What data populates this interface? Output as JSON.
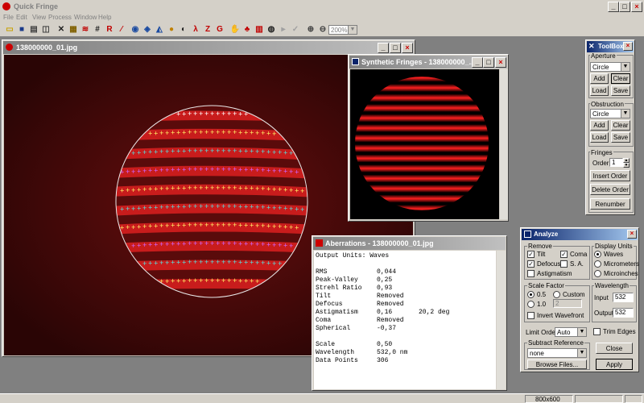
{
  "app": {
    "title": "Quick Fringe",
    "menu": [
      "File",
      "Edit",
      "View",
      "Process",
      "Window",
      "Help"
    ],
    "zoom_value": "200%"
  },
  "toolbar_icons": [
    "open-icon",
    "save-icon",
    "print-icon",
    "print-preview-icon",
    "tools-icon",
    "grid-icon",
    "fringe-icon",
    "table-icon",
    "r-icon",
    "measure-icon",
    "sphere-icon",
    "layers-icon",
    "profile-icon",
    "chart-icon",
    "zernike-icon",
    "lambda-icon",
    "z-icon",
    "g-icon",
    "hand-icon",
    "tree-icon",
    "fringe-map-icon",
    "circle-fringe-icon",
    "cursor-icon",
    "check-icon",
    "zoom-in-icon",
    "zoom-out-icon"
  ],
  "toolbar_letters": {
    "r": "R",
    "lambda": "λ",
    "z": "Z",
    "g": "G"
  },
  "image_window": {
    "title": "138000000_01.jpg"
  },
  "synthetic_window": {
    "title": "Synthetic Fringes - 138000000_..."
  },
  "aberrations_window": {
    "title": "Aberrations - 138000000_01.jpg",
    "header": "Output Units: Waves",
    "rows": [
      {
        "label": "RMS",
        "value": "0,044",
        "extra": ""
      },
      {
        "label": "Peak-Valley",
        "value": "0,25",
        "extra": ""
      },
      {
        "label": "Strehl Ratio",
        "value": "0,93",
        "extra": ""
      },
      {
        "label": "Tilt",
        "value": "Removed",
        "extra": ""
      },
      {
        "label": "Defocus",
        "value": "Removed",
        "extra": ""
      },
      {
        "label": "Astigmatism",
        "value": "0,16",
        "extra": "20,2 deg"
      },
      {
        "label": "Coma",
        "value": "Removed",
        "extra": ""
      },
      {
        "label": "Spherical",
        "value": "-0,37",
        "extra": ""
      }
    ],
    "rows2": [
      {
        "label": "Scale",
        "value": "0,50"
      },
      {
        "label": "Wavelength",
        "value": "532,0 nm"
      },
      {
        "label": "Data Points",
        "value": "306"
      }
    ]
  },
  "toolbox": {
    "title": "ToolBox",
    "aperture_label": "Aperture",
    "aperture_value": "Circle",
    "add": "Add",
    "clear": "Clear",
    "load": "Load",
    "save": "Save",
    "obstruction_label": "Obstruction",
    "obstruction_value": "Circle",
    "fringes_label": "Fringes",
    "order_label": "Order",
    "order_value": "1",
    "insert_order": "Insert Order",
    "delete_order": "Delete Order",
    "renumber": "Renumber"
  },
  "analyze": {
    "title": "Analyze",
    "remove_label": "Remove",
    "tilt": "Tilt",
    "coma": "Coma",
    "defocus": "Defocus",
    "sa": "S. A.",
    "astigmatism": "Astigmatism",
    "display_units_label": "Display Units",
    "waves": "Waves",
    "micrometers": "Micrometers",
    "microinches": "Microinches",
    "scale_factor_label": "Scale Factor",
    "scale_05": "0.5",
    "scale_custom": "Custom",
    "scale_10": "1.0",
    "custom_placeholder": "2",
    "invert_wavefront": "Invert Wavefront",
    "wavelength_label": "Wavelength",
    "input_label": "Input",
    "input_value": "532",
    "output_label": "Output",
    "output_value": "532",
    "limit_order_label": "Limit Order",
    "limit_order_value": "Auto",
    "trim_edges": "Trim Edges",
    "subtract_reference_label": "Subtract Reference",
    "subtract_value": "none",
    "browse_files": "Browse Files...",
    "close": "Close",
    "apply": "Apply"
  },
  "status": {
    "resolution": "800x600"
  },
  "colors": {
    "titlebar": "#0a246a",
    "fringe": "#d41a1a",
    "mdi_bg": "#808080",
    "face": "#d4d0c8"
  }
}
